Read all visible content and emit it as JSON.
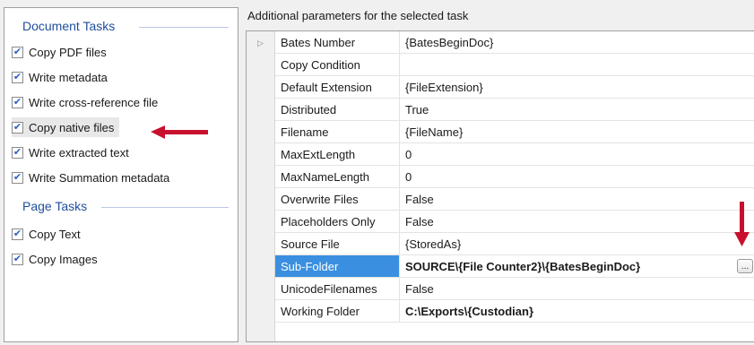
{
  "document_tasks": {
    "header": "Document Tasks",
    "items": [
      {
        "label": "Copy PDF files",
        "checked": true
      },
      {
        "label": "Write metadata",
        "checked": true
      },
      {
        "label": "Write cross-reference file",
        "checked": true
      },
      {
        "label": "Copy native files",
        "checked": true
      },
      {
        "label": "Write extracted text",
        "checked": true
      },
      {
        "label": "Write Summation metadata",
        "checked": true
      }
    ]
  },
  "page_tasks": {
    "header": "Page Tasks",
    "items": [
      {
        "label": "Copy Text",
        "checked": true
      },
      {
        "label": "Copy Images",
        "checked": true
      }
    ]
  },
  "params_header": "Additional parameters for the selected task",
  "properties": [
    {
      "name": "Bates Number",
      "value": "{BatesBeginDoc}"
    },
    {
      "name": "Copy Condition",
      "value": ""
    },
    {
      "name": "Default Extension",
      "value": "{FileExtension}"
    },
    {
      "name": "Distributed",
      "value": "True"
    },
    {
      "name": "Filename",
      "value": "{FileName}"
    },
    {
      "name": "MaxExtLength",
      "value": "0"
    },
    {
      "name": "MaxNameLength",
      "value": "0"
    },
    {
      "name": "Overwrite Files",
      "value": "False"
    },
    {
      "name": "Placeholders Only",
      "value": "False"
    },
    {
      "name": "Source File",
      "value": "{StoredAs}"
    },
    {
      "name": "Sub-Folder",
      "value": "SOURCE\\{File Counter2}\\{BatesBeginDoc}"
    },
    {
      "name": "UnicodeFilenames",
      "value": "False"
    },
    {
      "name": "Working Folder",
      "value": "C:\\Exports\\{Custodian}"
    }
  ],
  "ellipsis_label": "...",
  "colors": {
    "accent": "#1f4e9e",
    "selection": "#3b8fe0",
    "arrow": "#c8102e"
  }
}
